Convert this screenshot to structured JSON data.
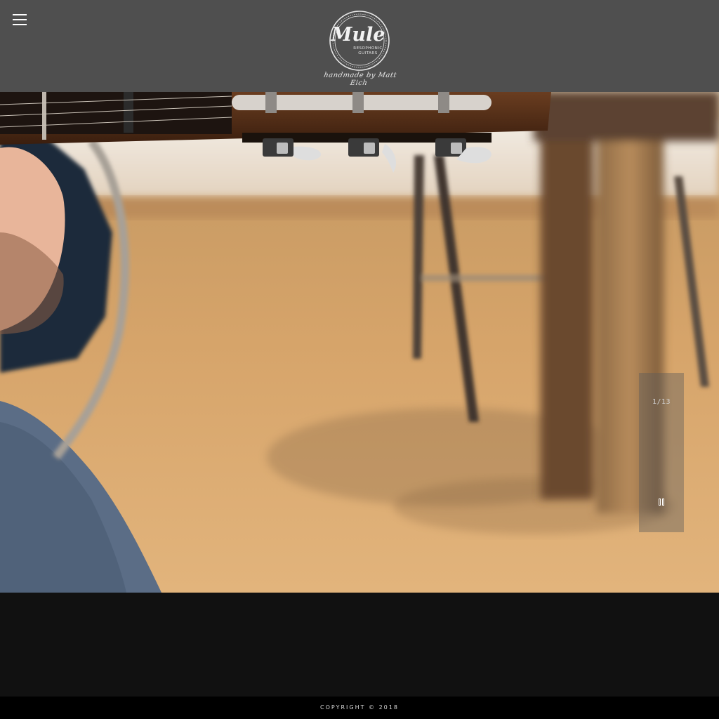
{
  "header": {
    "menu_icon": "hamburger-icon",
    "logo": {
      "brand": "Mule",
      "subtitle_line1": "RESOPHONIC",
      "subtitle_line2": "GUITARS",
      "tagline": "handmade by Matt Eich"
    }
  },
  "hero": {
    "image": "guitar-headstock-photo",
    "slide_counter": "1/13",
    "pause_icon": "pause-icon"
  },
  "footer": {
    "copyright": "COPYRIGHT © 2018"
  },
  "colors": {
    "header_bg": "#4f4f4f",
    "page_bg": "#111111",
    "footer_bg": "#000000"
  }
}
